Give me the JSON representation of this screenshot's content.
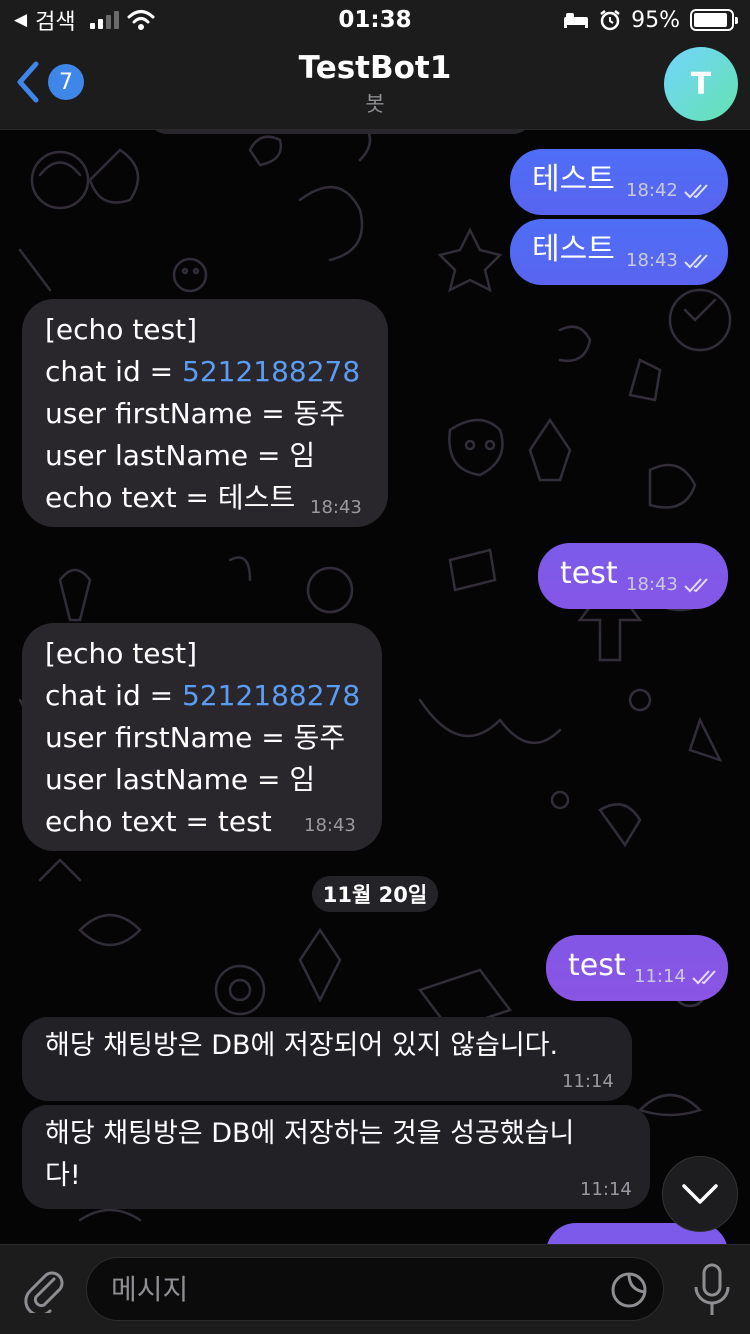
{
  "status_bar": {
    "back_label": "검색",
    "time": "01:38",
    "battery": "95%",
    "battery_level": 0.95
  },
  "header": {
    "back_count": "7",
    "title": "TestBot1",
    "subtitle": "봇",
    "avatar_letter": "T",
    "avatar_colors": [
      "#72d5fd",
      "#64e2b0"
    ]
  },
  "messages": [
    {
      "direction": "out",
      "text": "테스트",
      "time": "18:42",
      "read": true
    },
    {
      "direction": "out",
      "text": "테스트",
      "time": "18:43",
      "read": true
    },
    {
      "direction": "in",
      "lines": [
        "[echo test]",
        "chat id = ",
        "user firstName = 동주",
        "user lastName = 임",
        "echo text = 테스트"
      ],
      "chat_id": "5212188278",
      "time": "18:43"
    },
    {
      "direction": "out",
      "text": "test",
      "time": "18:43",
      "read": true
    },
    {
      "direction": "in",
      "lines": [
        "[echo test]",
        "chat id = ",
        "user firstName = 동주",
        "user lastName = 임",
        "echo text = test"
      ],
      "chat_id": "5212188278",
      "time": "18:43"
    },
    {
      "direction": "out",
      "text": "test",
      "time": "11:14",
      "read": true
    },
    {
      "direction": "in",
      "text": "해당 채팅방은 DB에 저장되어 있지 않습니다.",
      "time": "11:14"
    },
    {
      "direction": "in",
      "text": "해당 채팅방은 DB에 저장하는 것을 성공했습니\n다!",
      "time": "11:14"
    }
  ],
  "date_separator": "11월 20일",
  "input": {
    "placeholder": "메시지"
  },
  "colors": {
    "outgoing_blue": "#4e6ef6",
    "outgoing_purple": "#7b5bea",
    "incoming": "#2a272c",
    "link": "#5b9cf5",
    "badge": "#3e87e8"
  }
}
